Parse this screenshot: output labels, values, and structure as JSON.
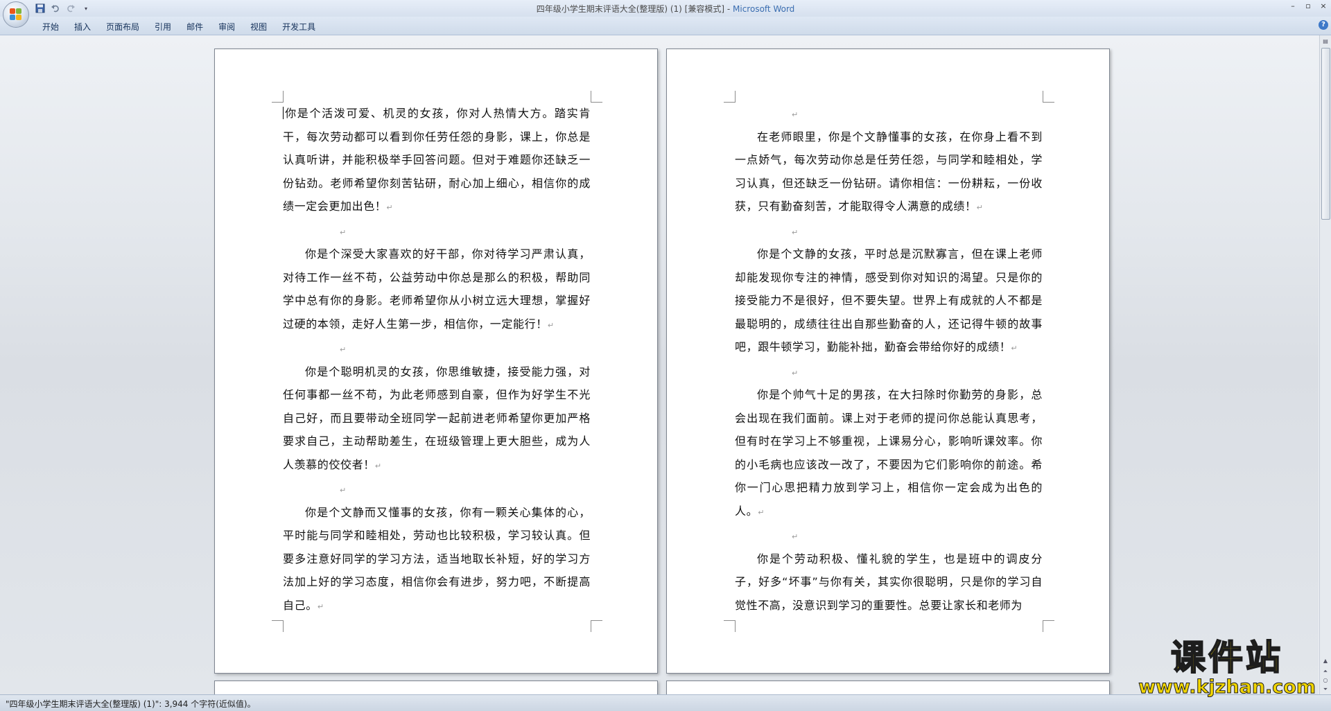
{
  "window": {
    "title": "四年级小学生期末评语大全(整理版) (1) [兼容模式]",
    "app_name": "Microsoft Word",
    "separator": " - "
  },
  "qat": {
    "icons": [
      "save-icon",
      "undo-icon",
      "redo-icon",
      "customize-icon"
    ]
  },
  "ribbon": {
    "tabs": [
      "开始",
      "插入",
      "页面布局",
      "引用",
      "邮件",
      "审阅",
      "视图",
      "开发工具"
    ],
    "help": "?"
  },
  "pages": [
    {
      "paragraphs": [
        {
          "text": "你是个活泼可爱、机灵的女孩，你对人热情大方。踏实肯干，每次劳动都可以看到你任劳任怨的身影，课上，你总是认真听讲，并能积极举手回答问题。但对于难题你还缺乏一份钻劲。老师希望你刻苦钻研，耐心加上细心，相信你的成绩一定会更加出色！",
          "indent": false,
          "caret": true
        },
        {
          "text": "",
          "indent": false
        },
        {
          "text": "你是个深受大家喜欢的好干部，你对待学习严肃认真，对待工作一丝不苟，公益劳动中你总是那么的积极，帮助同学中总有你的身影。老师希望你从小树立远大理想，掌握好过硬的本领，走好人生第一步，相信你，一定能行！",
          "indent": true
        },
        {
          "text": "",
          "indent": false
        },
        {
          "text": "你是个聪明机灵的女孩，你思维敏捷，接受能力强，对任何事都一丝不苟，为此老师感到自豪，但作为好学生不光自己好，而且要带动全班同学一起前进老师希望你更加严格要求自己，主动帮助差生，在班级管理上更大胆些，成为人人羡慕的佼佼者！",
          "indent": true
        },
        {
          "text": "",
          "indent": false
        },
        {
          "text": "你是个文静而又懂事的女孩，你有一颗关心集体的心，平时能与同学和睦相处，劳动也比较积极，学习较认真。但要多注意好同学的学习方法，适当地取长补短，好的学习方法加上好的学习态度，相信你会有进步，努力吧，不断提高自己。",
          "indent": true
        }
      ]
    },
    {
      "paragraphs": [
        {
          "text": "",
          "indent": false
        },
        {
          "text": "在老师眼里，你是个文静懂事的女孩，在你身上看不到一点娇气，每次劳动你总是任劳任怨，与同学和睦相处，学习认真，但还缺乏一份钻研。请你相信：一份耕耘，一份收获，只有勤奋刻苦，才能取得令人满意的成绩！",
          "indent": true
        },
        {
          "text": "",
          "indent": false
        },
        {
          "text": "你是个文静的女孩，平时总是沉默寡言，但在课上老师却能发现你专注的神情，感受到你对知识的渴望。只是你的接受能力不是很好，但不要失望。世界上有成就的人不都是最聪明的，成绩往往出自那些勤奋的人，还记得牛顿的故事吧，跟牛顿学习，勤能补拙，勤奋会带给你好的成绩！",
          "indent": true
        },
        {
          "text": "",
          "indent": false
        },
        {
          "text": "你是个帅气十足的男孩，在大扫除时你勤劳的身影，总会出现在我们面前。课上对于老师的提问你总能认真思考，但有时在学习上不够重视，上课易分心，影响听课效率。你的小毛病也应该改一改了，不要因为它们影响你的前途。希你一门心思把精力放到学习上，相信你一定会成为出色的人。",
          "indent": true
        },
        {
          "text": "",
          "indent": false
        },
        {
          "text": "你是个劳动积极、懂礼貌的学生，也是班中的调皮分子，好多“坏事”与你有关，其实你很聪明，只是你的学习自觉性不高，没意识到学习的重要性。总要让家长和老师为",
          "indent": true,
          "no_mark": true
        }
      ]
    }
  ],
  "paragraph_mark": "↵",
  "status": {
    "text": "\"四年级小学生期末评语大全(整理版) (1)\": 3,944 个字符(近似值)。"
  },
  "watermark": {
    "logo_text": "课件站",
    "url": "www.kjzhan.com"
  },
  "colors": {
    "accent": "#3a6db0",
    "watermark_yellow": "#f0d400"
  }
}
